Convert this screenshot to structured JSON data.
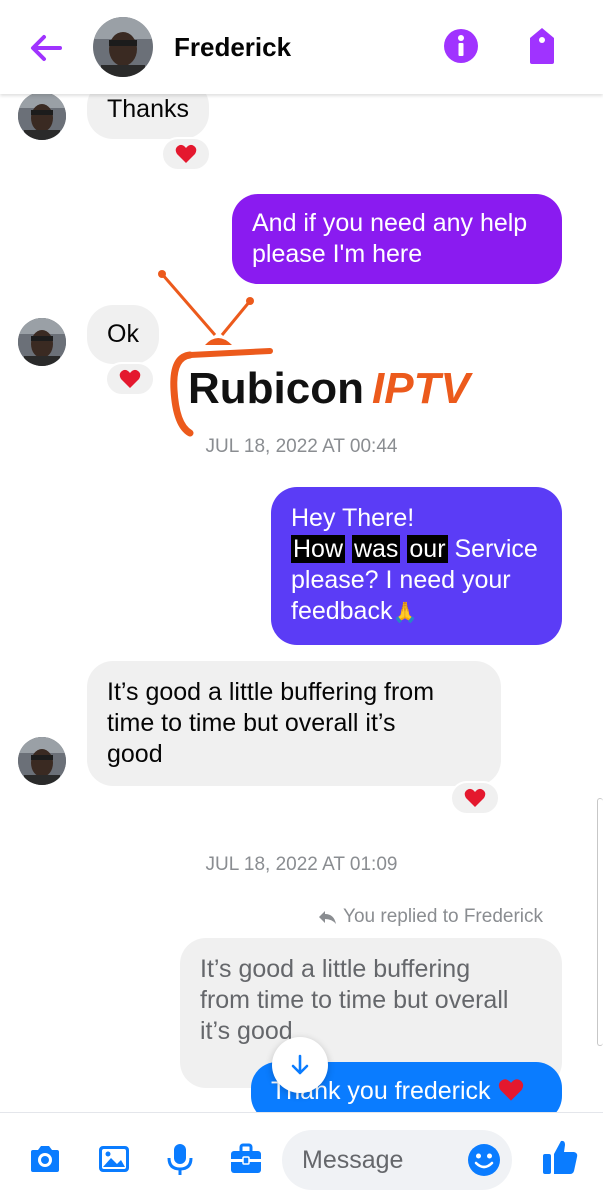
{
  "header": {
    "contact_name": "Frederick"
  },
  "messages": {
    "thanks": "Thanks",
    "help_line1": "And if you need any help",
    "help_line2": "please I'm here",
    "ok": "Ok",
    "hey_line1": "Hey There!",
    "hey_w1": "How",
    "hey_w2": "was",
    "hey_w3": "our",
    "hey_line2_rest": " Service",
    "hey_line3": "please? I need your",
    "hey_line4": "feedback",
    "hey_emoji": "🙏",
    "reply_line1": "It’s good a little buffering from",
    "reply_line2": "time to time but overall it’s",
    "reply_line3": "good",
    "quote_line1": "It’s good a little buffering",
    "quote_line2": "from time to time but overall",
    "quote_line3": "it’s good",
    "thank_you": "Thank you frederick"
  },
  "timestamps": {
    "t1": "JUL 18, 2022 AT 00:44",
    "t2": "JUL 18, 2022 AT 01:09"
  },
  "reply_notice": "You replied to Frederick",
  "watermark": {
    "brand": "Rubicon",
    "suffix": "IPTV"
  },
  "composer": {
    "placeholder": "Message"
  },
  "colors": {
    "accent_purple": "#8a1bf0",
    "indigo_bubble": "#5b3cf6",
    "blue_bubble": "#0a7cff",
    "messenger_blue": "#0a7cff",
    "heart_red": "#e4182e",
    "rubicon_orange": "#ec5a1c"
  },
  "icons": [
    "back-arrow-icon",
    "info-icon",
    "tag-icon",
    "heart-icon",
    "reply-arrow-icon",
    "arrow-down-icon",
    "camera-icon",
    "image-icon",
    "microphone-icon",
    "briefcase-icon",
    "emoji-icon",
    "thumbs-up-icon"
  ]
}
